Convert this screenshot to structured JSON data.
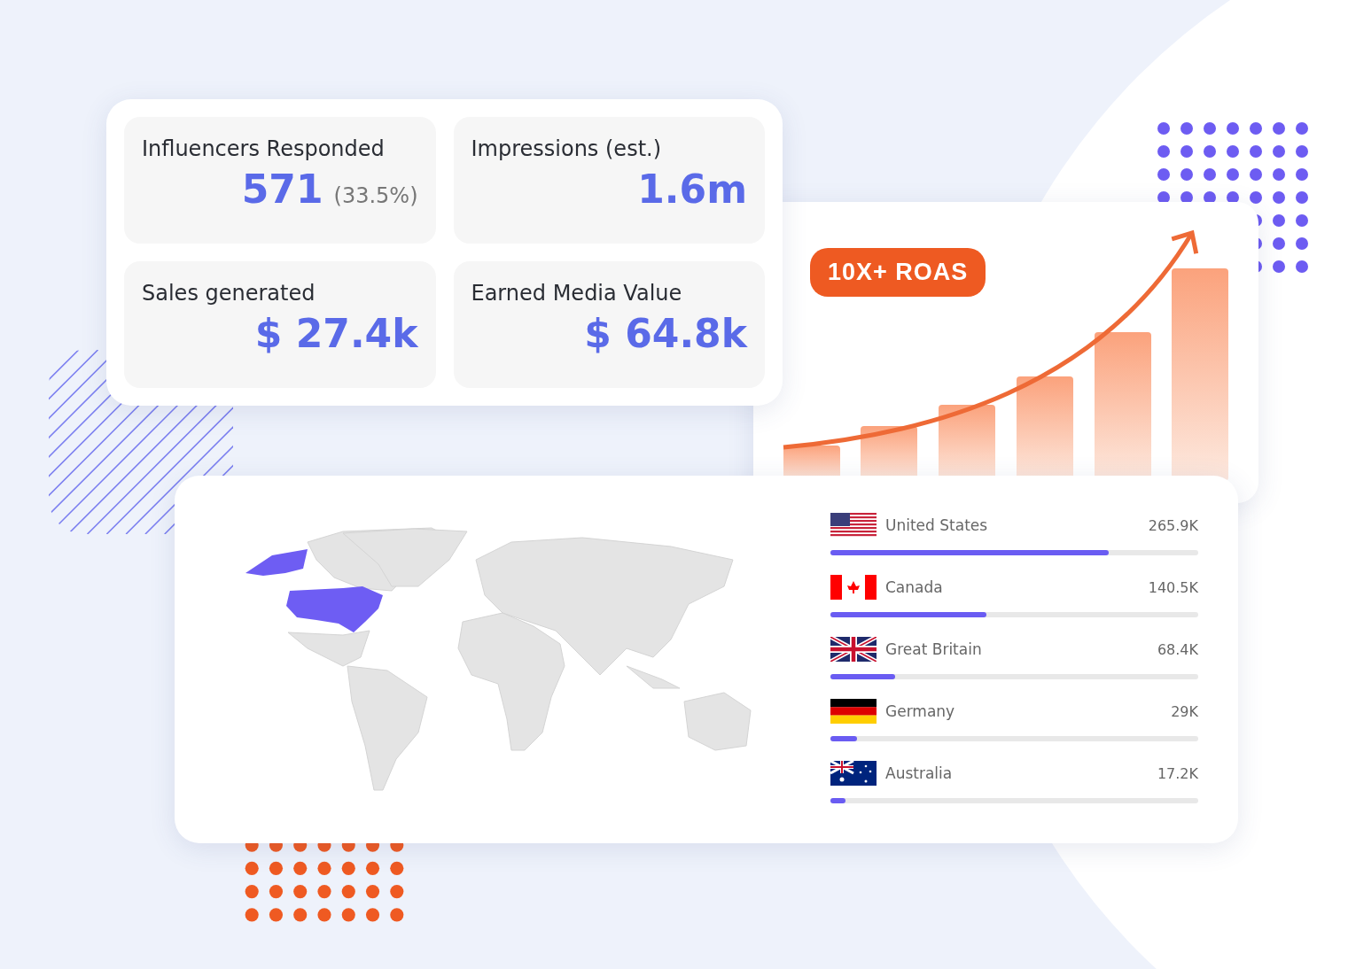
{
  "stats": [
    {
      "label": "Influencers Responded",
      "value": "571",
      "note": "(33.5%)"
    },
    {
      "label": "Impressions (est.)",
      "value": "1.6m"
    },
    {
      "label": "Sales generated",
      "value": "$ 27.4k"
    },
    {
      "label": "Earned Media Value",
      "value": "$ 64.8k"
    }
  ],
  "growth": {
    "badge": "10X+ ROAS"
  },
  "countries": [
    {
      "name": "United States",
      "value": "265.9K",
      "level": 0.757
    },
    {
      "name": "Canada",
      "value": "140.5K",
      "level": 0.425
    },
    {
      "name": "Great Britain",
      "value": "68.4K",
      "level": 0.177
    },
    {
      "name": "Germany",
      "value": "29K",
      "level": 0.072
    },
    {
      "name": "Australia",
      "value": "17.2K",
      "level": 0.042
    }
  ]
}
